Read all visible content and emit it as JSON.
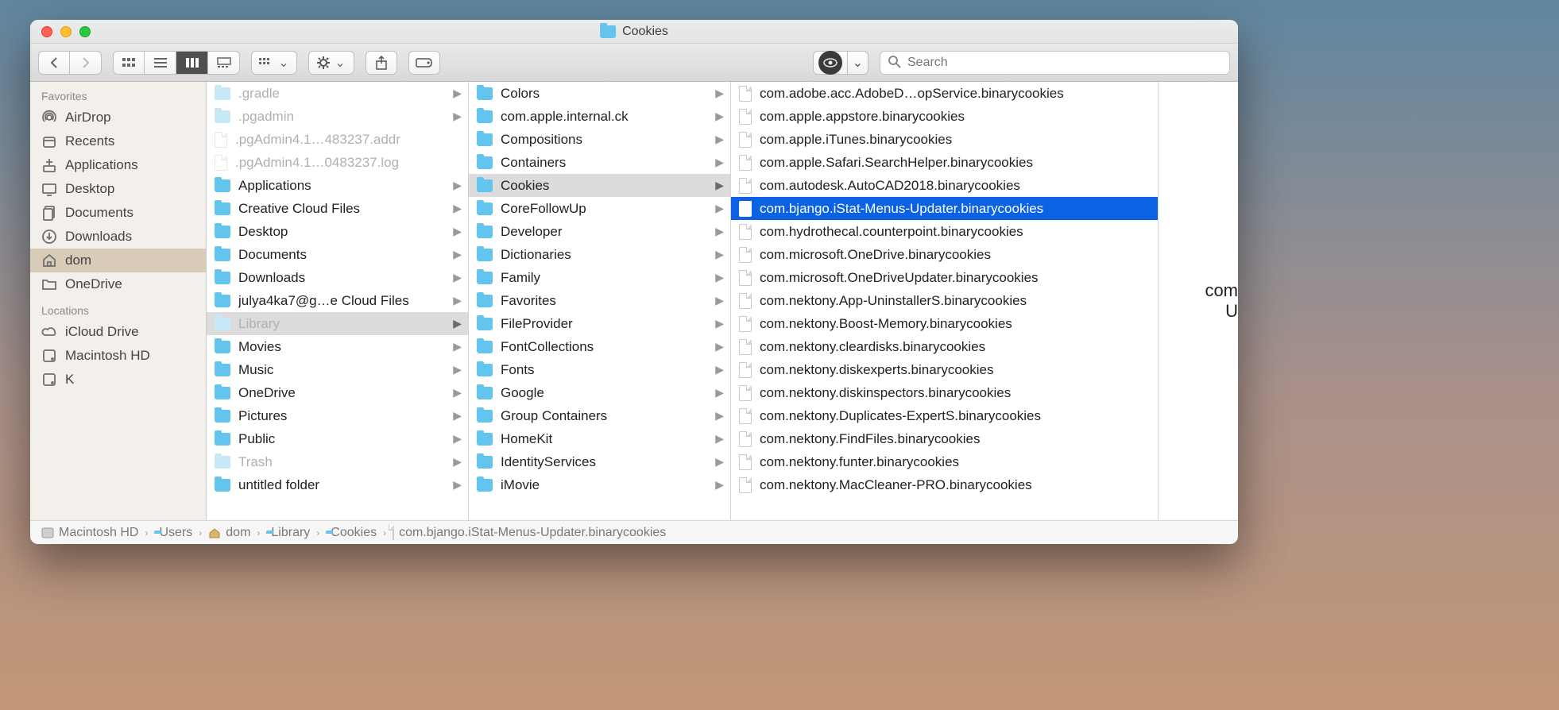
{
  "window": {
    "title": "Cookies"
  },
  "toolbar": {
    "search_placeholder": "Search"
  },
  "sidebar": {
    "sections": [
      {
        "header": "Favorites",
        "items": [
          {
            "icon": "airdrop",
            "label": "AirDrop"
          },
          {
            "icon": "recents",
            "label": "Recents"
          },
          {
            "icon": "apps",
            "label": "Applications"
          },
          {
            "icon": "desktop",
            "label": "Desktop"
          },
          {
            "icon": "documents",
            "label": "Documents"
          },
          {
            "icon": "downloads",
            "label": "Downloads"
          },
          {
            "icon": "home",
            "label": "dom",
            "selected": true
          },
          {
            "icon": "folder",
            "label": "OneDrive"
          }
        ]
      },
      {
        "header": "Locations",
        "items": [
          {
            "icon": "icloud",
            "label": "iCloud Drive"
          },
          {
            "icon": "disk",
            "label": "Macintosh HD"
          },
          {
            "icon": "disk",
            "label": "K"
          }
        ]
      }
    ]
  },
  "columns": {
    "c1": [
      {
        "name": ".gradle",
        "type": "folder",
        "dim": true,
        "has_children": true
      },
      {
        "name": ".pgadmin",
        "type": "folder",
        "dim": true,
        "has_children": true
      },
      {
        "name": ".pgAdmin4.1…483237.addr",
        "type": "file",
        "dim": true
      },
      {
        "name": ".pgAdmin4.1…0483237.log",
        "type": "file",
        "dim": true
      },
      {
        "name": "Applications",
        "type": "folder",
        "has_children": true
      },
      {
        "name": "Creative Cloud Files",
        "type": "folder",
        "has_children": true
      },
      {
        "name": "Desktop",
        "type": "folder",
        "has_children": true
      },
      {
        "name": "Documents",
        "type": "folder",
        "has_children": true
      },
      {
        "name": "Downloads",
        "type": "folder",
        "has_children": true
      },
      {
        "name": "julya4ka7@g…e Cloud Files",
        "type": "folder",
        "has_children": true
      },
      {
        "name": "Library",
        "type": "folder",
        "dim": true,
        "has_children": true,
        "selected": true
      },
      {
        "name": "Movies",
        "type": "folder",
        "has_children": true
      },
      {
        "name": "Music",
        "type": "folder",
        "has_children": true
      },
      {
        "name": "OneDrive",
        "type": "folder",
        "has_children": true
      },
      {
        "name": "Pictures",
        "type": "folder",
        "has_children": true
      },
      {
        "name": "Public",
        "type": "folder",
        "has_children": true
      },
      {
        "name": "Trash",
        "type": "folder",
        "dim": true,
        "has_children": true
      },
      {
        "name": "untitled folder",
        "type": "folder",
        "has_children": true
      }
    ],
    "c2": [
      {
        "name": "Colors",
        "type": "folder",
        "has_children": true
      },
      {
        "name": "com.apple.internal.ck",
        "type": "folder",
        "has_children": true
      },
      {
        "name": "Compositions",
        "type": "folder",
        "has_children": true
      },
      {
        "name": "Containers",
        "type": "folder",
        "has_children": true
      },
      {
        "name": "Cookies",
        "type": "folder",
        "has_children": true,
        "selected": true
      },
      {
        "name": "CoreFollowUp",
        "type": "folder",
        "has_children": true
      },
      {
        "name": "Developer",
        "type": "folder",
        "has_children": true
      },
      {
        "name": "Dictionaries",
        "type": "folder",
        "has_children": true
      },
      {
        "name": "Family",
        "type": "folder",
        "has_children": true
      },
      {
        "name": "Favorites",
        "type": "folder",
        "has_children": true
      },
      {
        "name": "FileProvider",
        "type": "folder",
        "has_children": true
      },
      {
        "name": "FontCollections",
        "type": "folder",
        "has_children": true
      },
      {
        "name": "Fonts",
        "type": "folder",
        "has_children": true
      },
      {
        "name": "Google",
        "type": "folder",
        "has_children": true
      },
      {
        "name": "Group Containers",
        "type": "folder",
        "has_children": true
      },
      {
        "name": "HomeKit",
        "type": "folder",
        "has_children": true
      },
      {
        "name": "IdentityServices",
        "type": "folder",
        "has_children": true
      },
      {
        "name": "iMovie",
        "type": "folder",
        "has_children": true
      }
    ],
    "c3": [
      {
        "name": "com.adobe.acc.AdobeD…opService.binarycookies",
        "type": "file"
      },
      {
        "name": "com.apple.appstore.binarycookies",
        "type": "file"
      },
      {
        "name": "com.apple.iTunes.binarycookies",
        "type": "file"
      },
      {
        "name": "com.apple.Safari.SearchHelper.binarycookies",
        "type": "file"
      },
      {
        "name": "com.autodesk.AutoCAD2018.binarycookies",
        "type": "file"
      },
      {
        "name": "com.bjango.iStat-Menus-Updater.binarycookies",
        "type": "file",
        "highlighted": true
      },
      {
        "name": "com.hydrothecal.counterpoint.binarycookies",
        "type": "file"
      },
      {
        "name": "com.microsoft.OneDrive.binarycookies",
        "type": "file"
      },
      {
        "name": "com.microsoft.OneDriveUpdater.binarycookies",
        "type": "file"
      },
      {
        "name": "com.nektony.App-UninstallerS.binarycookies",
        "type": "file"
      },
      {
        "name": "com.nektony.Boost-Memory.binarycookies",
        "type": "file"
      },
      {
        "name": "com.nektony.cleardisks.binarycookies",
        "type": "file"
      },
      {
        "name": "com.nektony.diskexperts.binarycookies",
        "type": "file"
      },
      {
        "name": "com.nektony.diskinspectors.binarycookies",
        "type": "file"
      },
      {
        "name": "com.nektony.Duplicates-ExpertS.binarycookies",
        "type": "file"
      },
      {
        "name": "com.nektony.FindFiles.binarycookies",
        "type": "file"
      },
      {
        "name": "com.nektony.funter.binarycookies",
        "type": "file"
      },
      {
        "name": "com.nektony.MacCleaner-PRO.binarycookies",
        "type": "file"
      }
    ],
    "preview_line1": "com",
    "preview_line2": "U"
  },
  "pathbar": [
    {
      "icon": "disk",
      "label": "Macintosh HD"
    },
    {
      "icon": "folder",
      "label": "Users"
    },
    {
      "icon": "home",
      "label": "dom"
    },
    {
      "icon": "folder",
      "label": "Library"
    },
    {
      "icon": "folder",
      "label": "Cookies"
    },
    {
      "icon": "file",
      "label": "com.bjango.iStat-Menus-Updater.binarycookies"
    }
  ]
}
